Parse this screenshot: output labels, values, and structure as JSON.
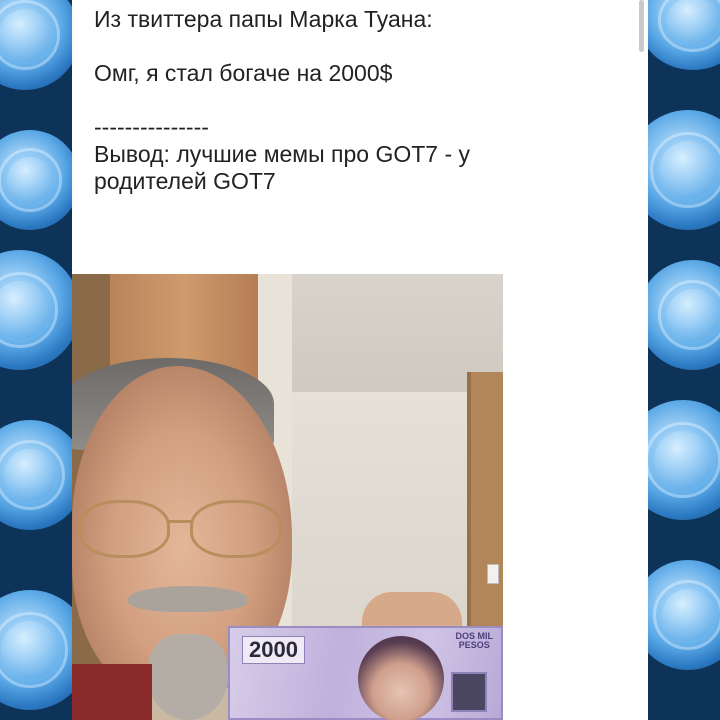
{
  "post": {
    "line1": "Из твиттера папы Марка Туана:",
    "line2": "Омг, я стал богаче на 2000$",
    "separator": "---------------",
    "line3": "Вывод: лучшие мемы про GOT7 - у",
    "line4": "родителей GOT7"
  },
  "photo": {
    "bill_value": "2000",
    "bill_caption_1": "DOS MIL",
    "bill_caption_2": "PESOS"
  },
  "colors": {
    "card_bg": "#ffffff",
    "text": "#222222",
    "flower_blue": "#5aa8e6"
  }
}
